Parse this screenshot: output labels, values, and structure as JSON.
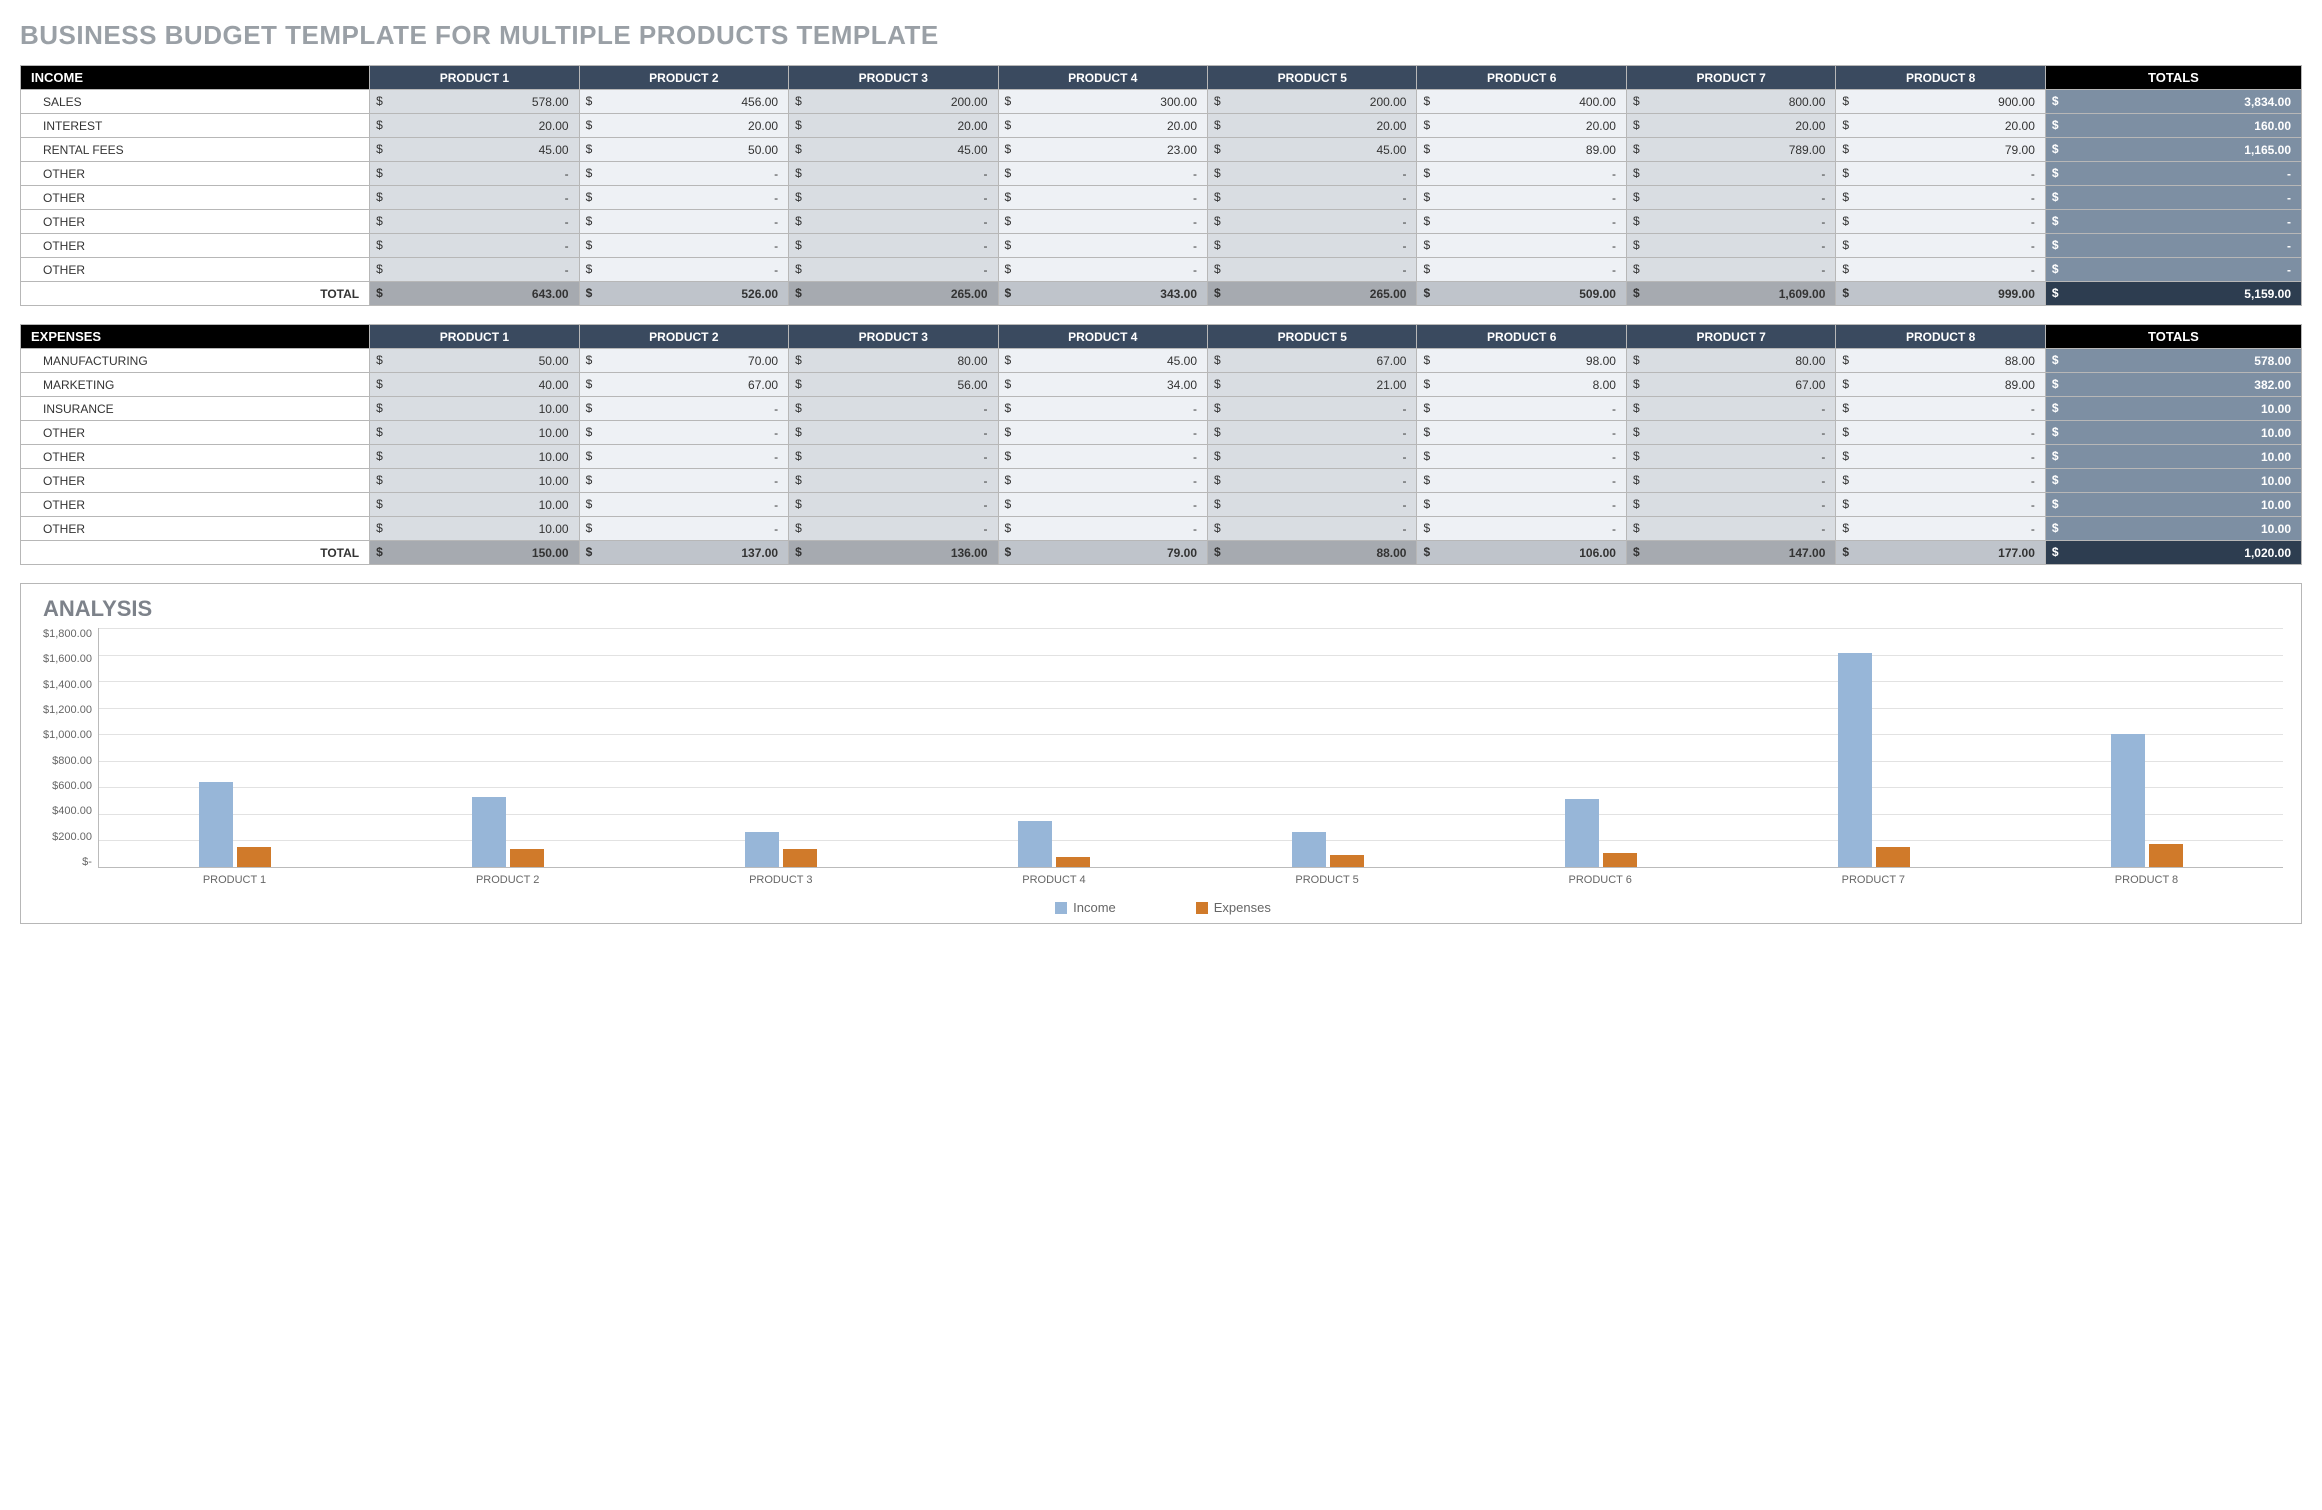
{
  "title": "BUSINESS BUDGET TEMPLATE FOR MULTIPLE PRODUCTS TEMPLATE",
  "currency": "$",
  "dash": "-",
  "products": [
    "PRODUCT 1",
    "PRODUCT 2",
    "PRODUCT 3",
    "PRODUCT 4",
    "PRODUCT 5",
    "PRODUCT 6",
    "PRODUCT 7",
    "PRODUCT 8"
  ],
  "totals_label": "TOTALS",
  "total_row_label": "TOTAL",
  "income": {
    "header": "INCOME",
    "rows": [
      {
        "label": "SALES",
        "values": [
          "578.00",
          "456.00",
          "200.00",
          "300.00",
          "200.00",
          "400.00",
          "800.00",
          "900.00"
        ],
        "total": "3,834.00"
      },
      {
        "label": "INTEREST",
        "values": [
          "20.00",
          "20.00",
          "20.00",
          "20.00",
          "20.00",
          "20.00",
          "20.00",
          "20.00"
        ],
        "total": "160.00"
      },
      {
        "label": "RENTAL FEES",
        "values": [
          "45.00",
          "50.00",
          "45.00",
          "23.00",
          "45.00",
          "89.00",
          "789.00",
          "79.00"
        ],
        "total": "1,165.00"
      },
      {
        "label": "OTHER",
        "values": [
          "-",
          "-",
          "-",
          "-",
          "-",
          "-",
          "-",
          "-"
        ],
        "total": "-"
      },
      {
        "label": "OTHER",
        "values": [
          "-",
          "-",
          "-",
          "-",
          "-",
          "-",
          "-",
          "-"
        ],
        "total": "-"
      },
      {
        "label": "OTHER",
        "values": [
          "-",
          "-",
          "-",
          "-",
          "-",
          "-",
          "-",
          "-"
        ],
        "total": "-"
      },
      {
        "label": "OTHER",
        "values": [
          "-",
          "-",
          "-",
          "-",
          "-",
          "-",
          "-",
          "-"
        ],
        "total": "-"
      },
      {
        "label": "OTHER",
        "values": [
          "-",
          "-",
          "-",
          "-",
          "-",
          "-",
          "-",
          "-"
        ],
        "total": "-"
      }
    ],
    "totals": [
      "643.00",
      "526.00",
      "265.00",
      "343.00",
      "265.00",
      "509.00",
      "1,609.00",
      "999.00"
    ],
    "grand_total": "5,159.00"
  },
  "expenses": {
    "header": "EXPENSES",
    "rows": [
      {
        "label": "MANUFACTURING",
        "values": [
          "50.00",
          "70.00",
          "80.00",
          "45.00",
          "67.00",
          "98.00",
          "80.00",
          "88.00"
        ],
        "total": "578.00"
      },
      {
        "label": "MARKETING",
        "values": [
          "40.00",
          "67.00",
          "56.00",
          "34.00",
          "21.00",
          "8.00",
          "67.00",
          "89.00"
        ],
        "total": "382.00"
      },
      {
        "label": "INSURANCE",
        "values": [
          "10.00",
          "-",
          "-",
          "-",
          "-",
          "-",
          "-",
          "-"
        ],
        "total": "10.00"
      },
      {
        "label": "OTHER",
        "values": [
          "10.00",
          "-",
          "-",
          "-",
          "-",
          "-",
          "-",
          "-"
        ],
        "total": "10.00"
      },
      {
        "label": "OTHER",
        "values": [
          "10.00",
          "-",
          "-",
          "-",
          "-",
          "-",
          "-",
          "-"
        ],
        "total": "10.00"
      },
      {
        "label": "OTHER",
        "values": [
          "10.00",
          "-",
          "-",
          "-",
          "-",
          "-",
          "-",
          "-"
        ],
        "total": "10.00"
      },
      {
        "label": "OTHER",
        "values": [
          "10.00",
          "-",
          "-",
          "-",
          "-",
          "-",
          "-",
          "-"
        ],
        "total": "10.00"
      },
      {
        "label": "OTHER",
        "values": [
          "10.00",
          "-",
          "-",
          "-",
          "-",
          "-",
          "-",
          "-"
        ],
        "total": "10.00"
      }
    ],
    "totals": [
      "150.00",
      "137.00",
      "136.00",
      "79.00",
      "88.00",
      "106.00",
      "147.00",
      "177.00"
    ],
    "grand_total": "1,020.00"
  },
  "chart_data": {
    "type": "bar",
    "title": "ANALYSIS",
    "categories": [
      "PRODUCT 1",
      "PRODUCT 2",
      "PRODUCT 3",
      "PRODUCT 4",
      "PRODUCT 5",
      "PRODUCT 6",
      "PRODUCT 7",
      "PRODUCT 8"
    ],
    "series": [
      {
        "name": "Income",
        "values": [
          643,
          526,
          265,
          343,
          265,
          509,
          1609,
          999
        ]
      },
      {
        "name": "Expenses",
        "values": [
          150,
          137,
          136,
          79,
          88,
          106,
          147,
          177
        ]
      }
    ],
    "ylim": [
      0,
      1800
    ],
    "yticks": [
      "$1,800.00",
      "$1,600.00",
      "$1,400.00",
      "$1,200.00",
      "$1,000.00",
      "$800.00",
      "$600.00",
      "$400.00",
      "$200.00",
      "$-"
    ],
    "xlabel": "",
    "ylabel": ""
  }
}
